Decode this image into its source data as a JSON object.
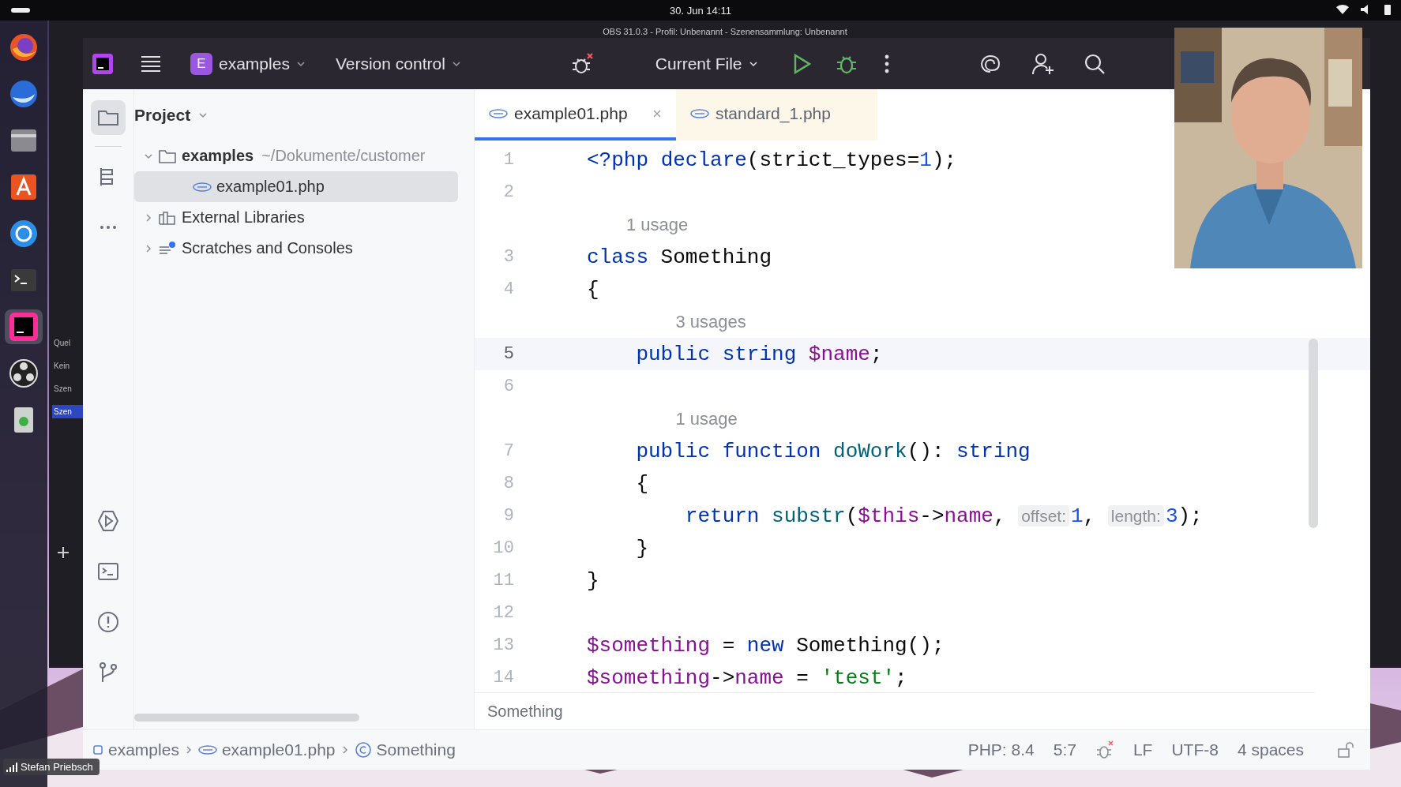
{
  "system_bar": {
    "date": "30. Jun 14:11"
  },
  "obs": {
    "title": "OBS 31.0.3 - Profil: Unbenannt - Szenensammlung: Unbenannt",
    "labels": [
      {
        "text": "Quel",
        "selected": false
      },
      {
        "text": "Kein",
        "selected": false
      },
      {
        "text": "Szen",
        "selected": false
      },
      {
        "text": "Szen",
        "selected": true
      }
    ]
  },
  "dock": {
    "apps": [
      {
        "kind": "browser",
        "selected": false
      },
      {
        "kind": "mail",
        "selected": false
      },
      {
        "kind": "files",
        "selected": false
      },
      {
        "kind": "store",
        "selected": false
      },
      {
        "kind": "help",
        "selected": false
      },
      {
        "kind": "terminal",
        "selected": false
      },
      {
        "kind": "ide",
        "selected": true
      },
      {
        "kind": "obs",
        "selected": false
      },
      {
        "kind": "trash",
        "selected": false
      }
    ]
  },
  "toolbar": {
    "project": {
      "badge": "E",
      "name": "examples"
    },
    "vcs": "Version control",
    "run_config": "Current File"
  },
  "tool_strip": {
    "top": [
      {
        "kind": "project",
        "selected": true
      },
      {
        "kind": "structure",
        "selected": false
      },
      {
        "kind": "more",
        "selected": false
      }
    ],
    "bottom": [
      {
        "kind": "run",
        "selected": false
      },
      {
        "kind": "terminal",
        "selected": false
      },
      {
        "kind": "problems",
        "selected": false
      },
      {
        "kind": "git",
        "selected": false
      }
    ]
  },
  "project_panel": {
    "title": "Project",
    "tree": [
      {
        "kind": "folder",
        "name": "examples",
        "path": "~/Dokumente/customer",
        "expanded": true,
        "selected": false,
        "children": [
          {
            "kind": "php",
            "name": "example01.php",
            "selected": true
          }
        ]
      },
      {
        "kind": "library",
        "name": "External Libraries",
        "expanded": false,
        "selected": false
      },
      {
        "kind": "scratches",
        "name": "Scratches and Consoles",
        "expanded": false,
        "selected": false
      }
    ]
  },
  "tabs": [
    {
      "name": "example01.php",
      "selected": true,
      "closable": true
    },
    {
      "name": "standard_1.php",
      "selected": false,
      "closable": false
    }
  ],
  "editor": {
    "lines": [
      {
        "kind": "code",
        "number": "1",
        "current": false,
        "tokens": [
          {
            "kind": "tag",
            "text": "<?php "
          },
          {
            "kind": "kw",
            "text": "declare"
          },
          {
            "kind": "plain",
            "text": "(strict_types="
          },
          {
            "kind": "num",
            "text": "1"
          },
          {
            "kind": "plain",
            "text": ");"
          }
        ]
      },
      {
        "kind": "code",
        "number": "2",
        "current": false
      },
      {
        "kind": "usage",
        "text": "1 usage"
      },
      {
        "kind": "code",
        "number": "3",
        "current": false,
        "tokens": [
          {
            "kind": "kw",
            "text": "class"
          },
          {
            "kind": "plain",
            "text": " Something"
          }
        ]
      },
      {
        "kind": "code",
        "number": "4",
        "current": false,
        "tokens": [
          {
            "kind": "plain",
            "text": "{"
          }
        ]
      },
      {
        "kind": "usage",
        "text": "3 usages"
      },
      {
        "kind": "code",
        "number": "5",
        "current": true,
        "tokens": [
          {
            "kind": "kw",
            "text": "    public string "
          },
          {
            "kind": "var",
            "text": "$name"
          },
          {
            "kind": "plain",
            "text": ";"
          }
        ]
      },
      {
        "kind": "code",
        "number": "6",
        "current": false
      },
      {
        "kind": "usage",
        "text": "1 usage"
      },
      {
        "kind": "code",
        "number": "7",
        "current": false,
        "tokens": [
          {
            "kind": "kw",
            "text": "    public function "
          },
          {
            "kind": "fn",
            "text": "doWork"
          },
          {
            "kind": "plain",
            "text": "(): "
          },
          {
            "kind": "kw",
            "text": "string"
          }
        ]
      },
      {
        "kind": "code",
        "number": "8",
        "current": false,
        "tokens": [
          {
            "kind": "plain",
            "text": "    {"
          }
        ]
      },
      {
        "kind": "code",
        "number": "9",
        "current": false,
        "tokens": [
          {
            "kind": "kw",
            "text": "        return "
          },
          {
            "kind": "fn",
            "text": "substr"
          },
          {
            "kind": "plain",
            "text": "("
          },
          {
            "kind": "var",
            "text": "$this"
          },
          {
            "kind": "plain",
            "text": "->"
          },
          {
            "kind": "field",
            "text": "name"
          },
          {
            "kind": "plain",
            "text": ", "
          },
          {
            "kind": "hint",
            "text": "offset:"
          },
          {
            "kind": "num",
            "text": "1"
          },
          {
            "kind": "plain",
            "text": ", "
          },
          {
            "kind": "hint",
            "text": "length:"
          },
          {
            "kind": "num",
            "text": "3"
          },
          {
            "kind": "plain",
            "text": ");"
          }
        ]
      },
      {
        "kind": "code",
        "number": "10",
        "current": false,
        "tokens": [
          {
            "kind": "plain",
            "text": "    }"
          }
        ]
      },
      {
        "kind": "code",
        "number": "11",
        "current": false,
        "tokens": [
          {
            "kind": "plain",
            "text": "}"
          }
        ]
      },
      {
        "kind": "code",
        "number": "12",
        "current": false
      },
      {
        "kind": "code",
        "number": "13",
        "current": false,
        "tokens": [
          {
            "kind": "var",
            "text": "$something"
          },
          {
            "kind": "plain",
            "text": " = "
          },
          {
            "kind": "kw",
            "text": "new"
          },
          {
            "kind": "plain",
            "text": " Something();"
          }
        ]
      },
      {
        "kind": "code",
        "number": "14",
        "current": false,
        "tokens": [
          {
            "kind": "var",
            "text": "$something"
          },
          {
            "kind": "plain",
            "text": "->"
          },
          {
            "kind": "field",
            "text": "name"
          },
          {
            "kind": "plain",
            "text": " = "
          },
          {
            "kind": "str",
            "text": "'test'"
          },
          {
            "kind": "plain",
            "text": ";"
          }
        ]
      }
    ],
    "footer": "Something"
  },
  "status_bar": {
    "breadcrumbs": [
      {
        "kind": "module",
        "text": "examples"
      },
      {
        "kind": "php",
        "text": "example01.php"
      },
      {
        "kind": "class",
        "text": "Something"
      }
    ],
    "items": [
      {
        "kind": "text",
        "text": "PHP: 8.4"
      },
      {
        "kind": "text",
        "text": "5:7"
      },
      {
        "kind": "bug"
      },
      {
        "kind": "text",
        "text": "LF"
      },
      {
        "kind": "text",
        "text": "UTF-8"
      },
      {
        "kind": "text",
        "text": "4 spaces"
      },
      {
        "kind": "lock"
      }
    ]
  },
  "name_tag": "Stefan Priebsch"
}
